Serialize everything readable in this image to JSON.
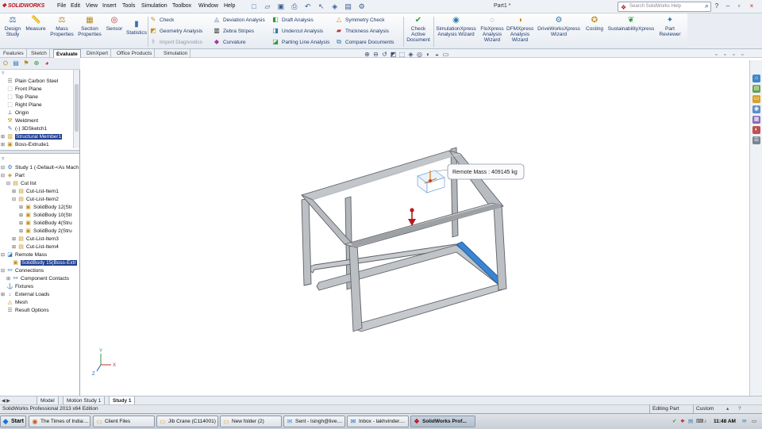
{
  "app": {
    "logo_text": "SOLIDWORKS",
    "document_title": "Part1 *"
  },
  "menu": [
    "File",
    "Edit",
    "View",
    "Insert",
    "Tools",
    "Simulation",
    "Toolbox",
    "Window",
    "Help"
  ],
  "search": {
    "placeholder": "Search SolidWorks Help"
  },
  "ribbon": {
    "design_study": "Design\nStudy",
    "measure": "Measure",
    "mass_properties": "Mass\nProperties",
    "section_properties": "Section\nProperties",
    "sensor": "Sensor",
    "statistics": "Statistics",
    "check": "Check",
    "geometry_analysis": "Geometry Analysis",
    "import_diagnostics": "Import Diagnostics",
    "deviation_analysis": "Deviation Analysis",
    "zebra_stripes": "Zebra Stripes",
    "curvature": "Curvature",
    "draft_analysis": "Draft Analysis",
    "undercut_analysis": "Undercut Analysis",
    "parting_line_analysis": "Parting Line Analysis",
    "symmetry_check": "Symmetry Check",
    "thickness_analysis": "Thickness Analysis",
    "compare_documents": "Compare Documents",
    "check_active_document": "Check\nActive\nDocument",
    "simulationxpress": "SimulationXpress\nAnalysis Wizard",
    "floxpress": "FloXpress\nAnalysis\nWizard",
    "dfmxpress": "DFMXpress\nAnalysis\nWizard",
    "driveworksxpress": "DriveWorksXpress\nWizard",
    "costing": "Costing",
    "sustainabilityxpress": "SustainabilityXpress",
    "part_reviewer": "Part\nReviewer"
  },
  "command_tabs": [
    "Features",
    "Sketch",
    "Evaluate",
    "DimXpert",
    "Office Products",
    "Simulation"
  ],
  "feature_tree": [
    "Plain Carbon Steel",
    "Front Plane",
    "Top Plane",
    "Right Plane",
    "Origin",
    "Weldment",
    "(-) 3DSketch1",
    "Structural Member1",
    "Boss-Extrude1"
  ],
  "study_tree": [
    "Study 1 (-Default-<As Mach",
    "Part",
    "Cut list",
    "Cut-List-Item1",
    "Cut-List-Item2",
    "SolidBody 12(Str",
    "SolidBody 10(Str",
    "SolidBody 4(Stru",
    "SolidBody 2(Stru",
    "Cut-List-Item3",
    "Cut-List-Item4",
    "Remote Mass",
    "SolidBody 15(Boss-Extr",
    "Connections",
    "Component Contacts",
    "Fixtures",
    "External Loads",
    "Mesh",
    "Result Options"
  ],
  "callout": {
    "text": "Remote Mass : 409145 kg"
  },
  "axes": {
    "x": "X",
    "y": "Y",
    "z": "Z"
  },
  "bottom_tabs": [
    "Model",
    "Motion Study 1",
    "Study 1"
  ],
  "status": {
    "left": "SolidWorks Professional 2013 x64 Edition",
    "mode": "Editing Part",
    "units": "Custom"
  },
  "taskbar": {
    "start": "Start",
    "items": [
      "The Times of India:...",
      "Client Files",
      "Jib Crane (C114001)",
      "New folder (2)",
      "Sent - lsingh@live....",
      "Inbox - lakhvinder....",
      "SolidWorks Prof..."
    ],
    "clock": "11:48 AM"
  },
  "colors": {
    "accent_red": "#c0141b",
    "selection_blue": "#1f3f8f",
    "frame_gray": "#b9bcc0"
  }
}
